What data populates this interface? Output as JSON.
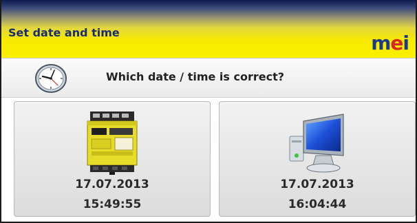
{
  "header": {
    "title": "Set date and time",
    "logo": {
      "m": "m",
      "e": "e",
      "i": "i"
    }
  },
  "question": {
    "icon": "clock-icon",
    "text": "Which date / time is correct?"
  },
  "choices": [
    {
      "icon": "controller-device-icon",
      "date": "17.07.2013",
      "time": "15:49:55"
    },
    {
      "icon": "computer-monitor-icon",
      "date": "17.07.2013",
      "time": "16:04:44"
    }
  ],
  "colors": {
    "header_top": "#0c1a4e",
    "header_bottom": "#fbf000",
    "title": "#1c2d6e",
    "logo_blue": "#1c3a8a",
    "logo_red": "#d8281e"
  }
}
